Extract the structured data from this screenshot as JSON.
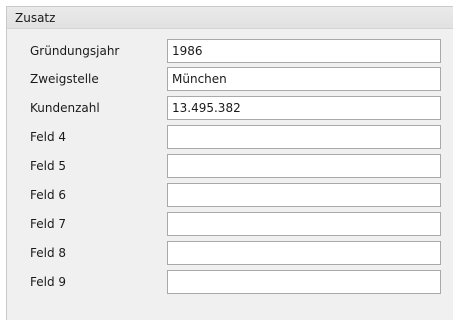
{
  "panel": {
    "title": "Zusatz"
  },
  "fields": [
    {
      "label": "Gründungsjahr",
      "value": "1986"
    },
    {
      "label": "Zweigstelle",
      "value": "München"
    },
    {
      "label": "Kundenzahl",
      "value": "13.495.382"
    },
    {
      "label": "Feld 4",
      "value": ""
    },
    {
      "label": "Feld 5",
      "value": ""
    },
    {
      "label": "Feld 6",
      "value": ""
    },
    {
      "label": "Feld 7",
      "value": ""
    },
    {
      "label": "Feld 8",
      "value": ""
    },
    {
      "label": "Feld 9",
      "value": ""
    }
  ],
  "colors": {
    "panel_background": "#f0f0f0",
    "header_background": "#e4e4e4",
    "field_border": "#a9a9a9"
  }
}
